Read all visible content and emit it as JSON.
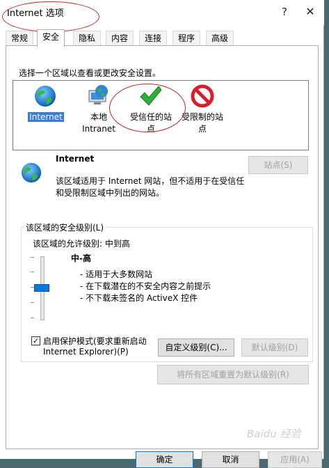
{
  "window": {
    "title": "Internet 选项",
    "help_glyph": "?",
    "close_glyph": "✕"
  },
  "tabs": [
    "常规",
    "安全",
    "隐私",
    "内容",
    "连接",
    "程序",
    "高级"
  ],
  "active_tab": "安全",
  "zones": {
    "prompt": "选择一个区域以查看或更改安全设置。",
    "items": [
      {
        "line1": "Internet",
        "line2": "",
        "icon": "globe-icon",
        "selected": true
      },
      {
        "line1": "本地",
        "line2": "Intranet",
        "icon": "intranet-icon",
        "selected": false
      },
      {
        "line1": "受信任的站",
        "line2": "点",
        "icon": "checkmark-icon",
        "selected": false
      },
      {
        "line1": "受限制的站",
        "line2": "点",
        "icon": "no-entry-icon",
        "selected": false
      }
    ]
  },
  "zone_info": {
    "name": "Internet",
    "desc_line1": "该区域适用于 Internet 网站，但不适用于在受信任",
    "desc_line2": "和受限制区域中列出的网站。",
    "sites_button": "站点(S)"
  },
  "security_level": {
    "group_label": "该区域的安全级别(L)",
    "allowed_levels": "该区域的允许级别: 中到高",
    "level_name": "中-高",
    "bullets": [
      "- 适用于大多数网站",
      "- 在下载潜在的不安全内容之前提示",
      "- 不下载未签名的 ActiveX 控件"
    ],
    "slider_level": "中-高",
    "protected_mode_label_line1": "启用保护模式(要求重新启动",
    "protected_mode_label_line2": "Internet Explorer)(P)",
    "protected_mode_checked": true,
    "check_glyph": "✓",
    "custom_level_button": "自定义级别(C)...",
    "default_level_button": "默认级别(D)",
    "reset_all_button": "将所有区域重置为默认级别(R)"
  },
  "bottom_buttons": [
    "确定",
    "取消",
    "应用(A)"
  ],
  "watermark": "Baidu 经验"
}
